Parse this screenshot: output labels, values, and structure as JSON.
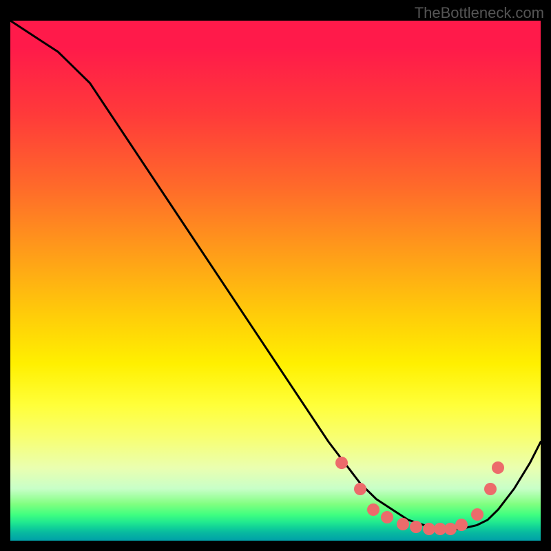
{
  "watermark": "TheBottleneck.com",
  "chart_data": {
    "type": "line",
    "title": "",
    "xlabel": "",
    "ylabel": "",
    "xrange": [
      0,
      100
    ],
    "yrange": [
      0,
      100
    ],
    "grid": false,
    "series": [
      {
        "name": "curve",
        "stroke": "#000000",
        "x": [
          0,
          3,
          6,
          9,
          12,
          15,
          60,
          63,
          66,
          69,
          72,
          75,
          78,
          81,
          84,
          86,
          88,
          90,
          92,
          95,
          98,
          100
        ],
        "y": [
          100,
          98,
          96,
          94,
          91,
          88,
          19,
          15,
          11,
          8,
          6,
          4,
          3,
          2.3,
          2.2,
          2.5,
          3,
          4,
          6,
          10,
          15,
          19
        ]
      }
    ],
    "points": [
      {
        "x": 62.5,
        "y": 15
      },
      {
        "x": 66,
        "y": 10
      },
      {
        "x": 68.5,
        "y": 6
      },
      {
        "x": 71,
        "y": 4.5
      },
      {
        "x": 74,
        "y": 3.2
      },
      {
        "x": 76.5,
        "y": 2.7
      },
      {
        "x": 79,
        "y": 2.3
      },
      {
        "x": 81,
        "y": 2.2
      },
      {
        "x": 83,
        "y": 2.3
      },
      {
        "x": 85,
        "y": 3.0
      },
      {
        "x": 88,
        "y": 5.0
      },
      {
        "x": 90.5,
        "y": 10
      },
      {
        "x": 92,
        "y": 14
      }
    ],
    "point_color": "#ec6b6b",
    "background_gradient_top": "#ff1a4a",
    "background_gradient_bottom": "#00a0a8"
  }
}
